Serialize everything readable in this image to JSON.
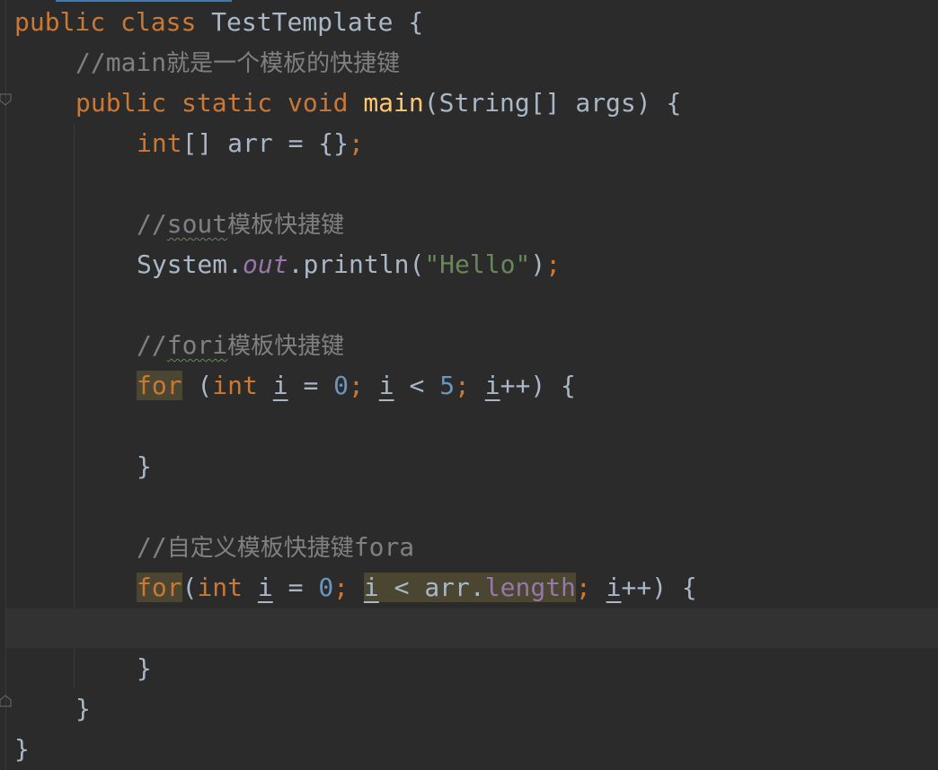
{
  "editor": {
    "lines": [
      {
        "id": "class-decl",
        "tokens": [
          {
            "t": "public ",
            "c": "kw"
          },
          {
            "t": "class ",
            "c": "kw"
          },
          {
            "t": "TestTemplate {",
            "c": "plain"
          }
        ]
      },
      {
        "id": "comment-main",
        "tokens": [
          {
            "t": "//main",
            "c": "cmt"
          },
          {
            "t": "就是一个模板的快捷键",
            "c": "cmt cjk"
          }
        ]
      },
      {
        "id": "main-decl",
        "tokens": [
          {
            "t": "public ",
            "c": "kw"
          },
          {
            "t": "static ",
            "c": "kw"
          },
          {
            "t": "void ",
            "c": "kw"
          },
          {
            "t": "main",
            "c": "fn"
          },
          {
            "t": "(String[] args) {",
            "c": "plain"
          }
        ]
      },
      {
        "id": "arr-decl",
        "tokens": [
          {
            "t": "int",
            "c": "kw"
          },
          {
            "t": "[] arr = {}",
            "c": "plain"
          },
          {
            "t": ";",
            "c": "kw"
          }
        ]
      },
      {
        "id": "blank-1",
        "tokens": []
      },
      {
        "id": "comment-sout",
        "tokens": [
          {
            "t": "//",
            "c": "cmt"
          },
          {
            "t": "sout",
            "c": "cmt typo"
          },
          {
            "t": "模板快捷键",
            "c": "cmt cjk"
          }
        ]
      },
      {
        "id": "println",
        "tokens": [
          {
            "t": "System.",
            "c": "plain"
          },
          {
            "t": "out",
            "c": "fld it"
          },
          {
            "t": ".println(",
            "c": "plain"
          },
          {
            "t": "\"Hello\"",
            "c": "str"
          },
          {
            "t": ")",
            "c": "plain"
          },
          {
            "t": ";",
            "c": "kw"
          }
        ]
      },
      {
        "id": "blank-2",
        "tokens": []
      },
      {
        "id": "comment-fori",
        "tokens": [
          {
            "t": "//",
            "c": "cmt"
          },
          {
            "t": "fori",
            "c": "cmt typo"
          },
          {
            "t": "模板快捷键",
            "c": "cmt cjk"
          }
        ]
      },
      {
        "id": "for-loop-1",
        "tokens": [
          {
            "t": "for",
            "c": "kw hl"
          },
          {
            "t": " (",
            "c": "plain"
          },
          {
            "t": "int ",
            "c": "kw"
          },
          {
            "t": "i",
            "c": "plain var"
          },
          {
            "t": " = ",
            "c": "plain"
          },
          {
            "t": "0",
            "c": "num"
          },
          {
            "t": "; ",
            "c": "kw"
          },
          {
            "t": "i",
            "c": "plain var"
          },
          {
            "t": " < ",
            "c": "plain"
          },
          {
            "t": "5",
            "c": "num"
          },
          {
            "t": "; ",
            "c": "kw"
          },
          {
            "t": "i",
            "c": "plain var"
          },
          {
            "t": "++) {",
            "c": "plain"
          }
        ]
      },
      {
        "id": "blank-3",
        "tokens": []
      },
      {
        "id": "close-for-1",
        "tokens": [
          {
            "t": "}",
            "c": "plain"
          }
        ]
      },
      {
        "id": "blank-4",
        "tokens": []
      },
      {
        "id": "comment-custom",
        "tokens": [
          {
            "t": "//",
            "c": "cmt"
          },
          {
            "t": "自定义模板快捷键",
            "c": "cmt cjk"
          },
          {
            "t": "fora",
            "c": "cmt"
          }
        ]
      },
      {
        "id": "for-loop-2",
        "tokens": [
          {
            "t": "for",
            "c": "kw hl"
          },
          {
            "t": "(",
            "c": "plain"
          },
          {
            "t": "int ",
            "c": "kw"
          },
          {
            "t": "i",
            "c": "plain var"
          },
          {
            "t": " = ",
            "c": "plain"
          },
          {
            "t": "0",
            "c": "num"
          },
          {
            "t": "; ",
            "c": "kw"
          },
          {
            "t": "i",
            "c": "plain var hl"
          },
          {
            "t": " < arr.",
            "c": "plain hl"
          },
          {
            "t": "length",
            "c": "fld hl"
          },
          {
            "t": "; ",
            "c": "kw"
          },
          {
            "t": "i",
            "c": "plain var"
          },
          {
            "t": "++) {",
            "c": "plain"
          }
        ]
      },
      {
        "id": "blank-caret",
        "tokens": []
      },
      {
        "id": "close-for-2",
        "tokens": [
          {
            "t": "}",
            "c": "plain"
          }
        ]
      },
      {
        "id": "close-main",
        "tokens": [
          {
            "t": "}",
            "c": "plain"
          }
        ]
      },
      {
        "id": "close-class",
        "tokens": [
          {
            "t": "}",
            "c": "plain"
          }
        ]
      }
    ]
  }
}
